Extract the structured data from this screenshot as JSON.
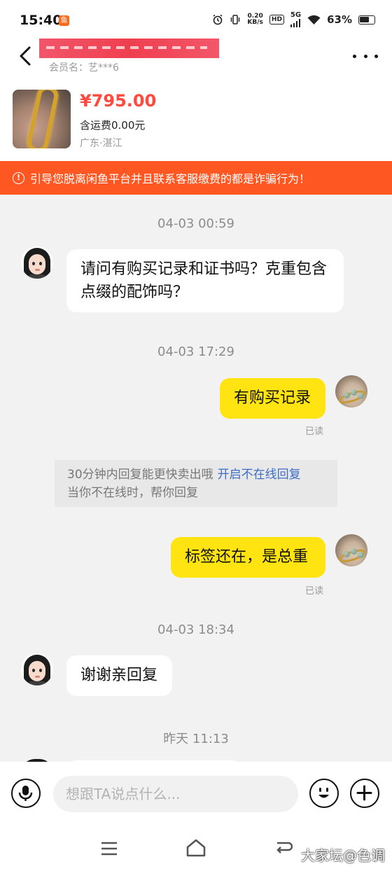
{
  "status_bar": {
    "time": "15:40",
    "app_notification_icon": "xianyu-icon",
    "net_speed_value": "0.20",
    "net_speed_unit": "KB/s",
    "hd": "HD",
    "network": "5G",
    "battery": "63%"
  },
  "header": {
    "member_label": "会员名：艺***6"
  },
  "product": {
    "price": "¥795.00",
    "shipping": "含运费0.00元",
    "location": "广东·湛江"
  },
  "warning": {
    "text": "引导您脱离闲鱼平台并且联系客服缴费的都是诈骗行为！"
  },
  "chat": {
    "messages": [
      {
        "type": "timestamp",
        "text": "04-03 00:59"
      },
      {
        "type": "received",
        "text": "请问有购买记录和证书吗？克重包含点缀的配饰吗？"
      },
      {
        "type": "timestamp",
        "text": "04-03 17:29"
      },
      {
        "type": "sent",
        "text": "有购买记录",
        "status": "已读"
      },
      {
        "type": "tip",
        "text": "30分钟内回复能更快卖出哦",
        "link": "开启不在线回复",
        "text2": "当你不在线时，帮你回复"
      },
      {
        "type": "sent",
        "text": "标签还在，是总重",
        "status": "已读"
      },
      {
        "type": "timestamp",
        "text": "04-03 18:34"
      },
      {
        "type": "received",
        "text": "谢谢亲回复"
      },
      {
        "type": "timestamp",
        "text": "昨天 11:13"
      }
    ]
  },
  "input": {
    "placeholder": "想跟TA说点什么..."
  },
  "watermark": "大家坛@色调",
  "colors": {
    "accent_orange": "#ff5722",
    "price_red": "#ff4a3d",
    "sent_bubble": "#ffe411",
    "link_blue": "#3c6dc4"
  }
}
